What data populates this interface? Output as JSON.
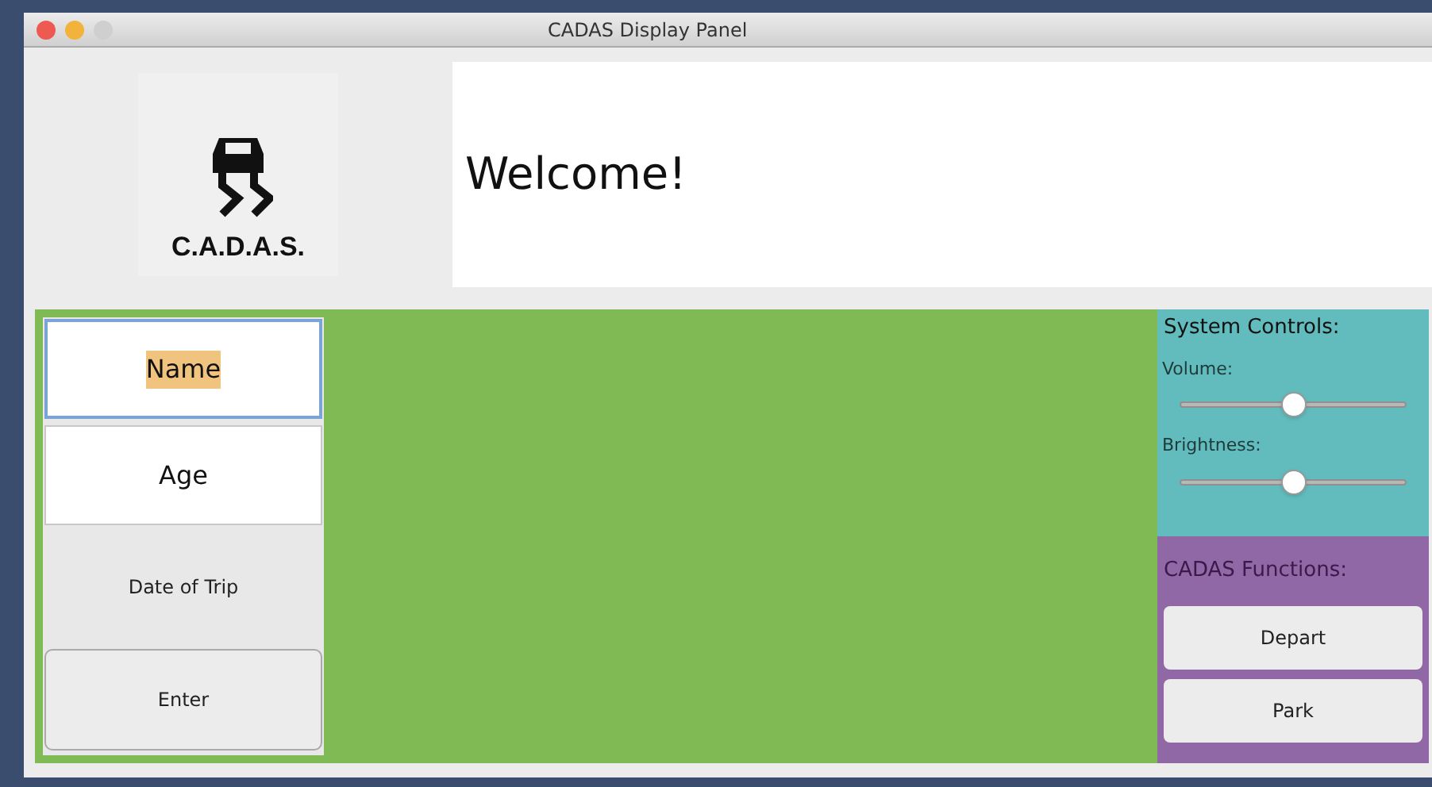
{
  "window": {
    "title": "CADAS Display Panel"
  },
  "logo": {
    "text": "C.A.D.A.S."
  },
  "welcome": "Welcome!",
  "fields": [
    {
      "value": "Name",
      "focused": true
    },
    {
      "value": "Age",
      "focused": false
    }
  ],
  "date_label": "Date of Trip",
  "enter_button": "Enter",
  "system_controls": {
    "title": "System Controls:",
    "sliders": [
      {
        "label": "Volume:",
        "level": 0.5
      },
      {
        "label": "Brightness:",
        "level": 0.5
      }
    ]
  },
  "functions": {
    "title": "CADAS Functions:",
    "buttons": [
      "Depart",
      "Park"
    ]
  }
}
